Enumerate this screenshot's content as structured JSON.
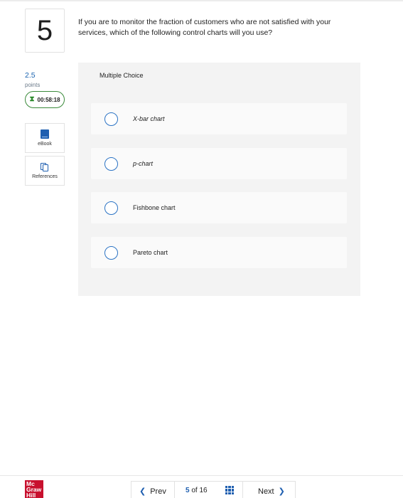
{
  "question": {
    "number": "5",
    "text": "If you are to monitor the fraction of customers who are not satisfied with your services, which of the following control charts will you use?"
  },
  "sidebar": {
    "points_value": "2.5",
    "points_label": "points",
    "timer": "00:58:18",
    "tools": [
      {
        "label": "eBook",
        "icon": "book-icon"
      },
      {
        "label": "References",
        "icon": "references-icon"
      }
    ]
  },
  "answer_panel": {
    "type_label": "Multiple Choice",
    "options": [
      {
        "label": "X-bar chart",
        "selected": false
      },
      {
        "label": "p-chart",
        "selected": false
      },
      {
        "label": "Fishbone chart",
        "selected": false
      },
      {
        "label": "Pareto chart",
        "selected": false
      }
    ]
  },
  "footer": {
    "logo_text": "Mc Graw Hill",
    "prev_label": "Prev",
    "next_label": "Next",
    "current_page": "5",
    "of_label": "of",
    "total_pages": "16"
  },
  "colors": {
    "accent": "#1f5fb0",
    "timer_border": "#3a8a3a",
    "logo_red": "#c8102e",
    "panel_bg": "#f3f3f3"
  }
}
